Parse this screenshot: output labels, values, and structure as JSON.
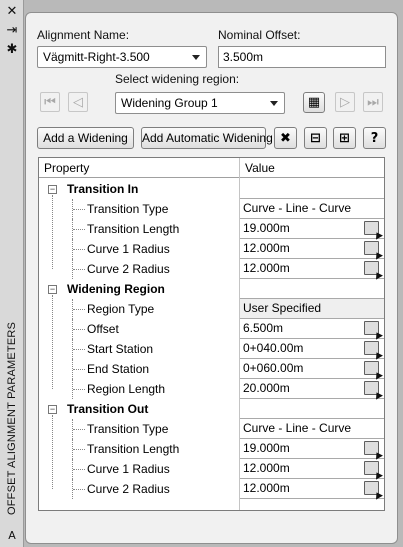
{
  "palette_title": "OFFSET ALIGNMENT PARAMETERS",
  "side_icons": [
    "close-icon",
    "pin-icon",
    "settings-icon"
  ],
  "alignment": {
    "label": "Alignment Name:",
    "value": "Vägmitt-Right-3.500"
  },
  "offset": {
    "label": "Nominal Offset:",
    "value": "3.500m"
  },
  "region": {
    "label": "Select widening region:",
    "value": "Widening Group 1"
  },
  "buttons": {
    "add_widening": "Add a Widening",
    "add_auto": "Add Automatic Widening"
  },
  "grid": {
    "headers": {
      "property": "Property",
      "value": "Value"
    },
    "groups": [
      {
        "name": "Transition In",
        "rows": [
          {
            "name": "Transition Type",
            "value": "Curve - Line - Curve",
            "pick": false
          },
          {
            "name": "Transition Length",
            "value": "19.000m",
            "pick": true
          },
          {
            "name": "Curve 1 Radius",
            "value": "12.000m",
            "pick": true
          },
          {
            "name": "Curve 2 Radius",
            "value": "12.000m",
            "pick": true
          }
        ]
      },
      {
        "name": "Widening Region",
        "rows": [
          {
            "name": "Region Type",
            "value": "User Specified",
            "pick": false,
            "readonly": true
          },
          {
            "name": "Offset",
            "value": "6.500m",
            "pick": true
          },
          {
            "name": "Start Station",
            "value": "0+040.00m",
            "pick": true
          },
          {
            "name": "End Station",
            "value": "0+060.00m",
            "pick": true
          },
          {
            "name": "Region Length",
            "value": "20.000m",
            "pick": true
          }
        ]
      },
      {
        "name": "Transition Out",
        "rows": [
          {
            "name": "Transition Type",
            "value": "Curve - Line - Curve",
            "pick": false
          },
          {
            "name": "Transition Length",
            "value": "19.000m",
            "pick": true
          },
          {
            "name": "Curve 1 Radius",
            "value": "12.000m",
            "pick": true
          },
          {
            "name": "Curve 2 Radius",
            "value": "12.000m",
            "pick": true
          }
        ]
      }
    ]
  }
}
